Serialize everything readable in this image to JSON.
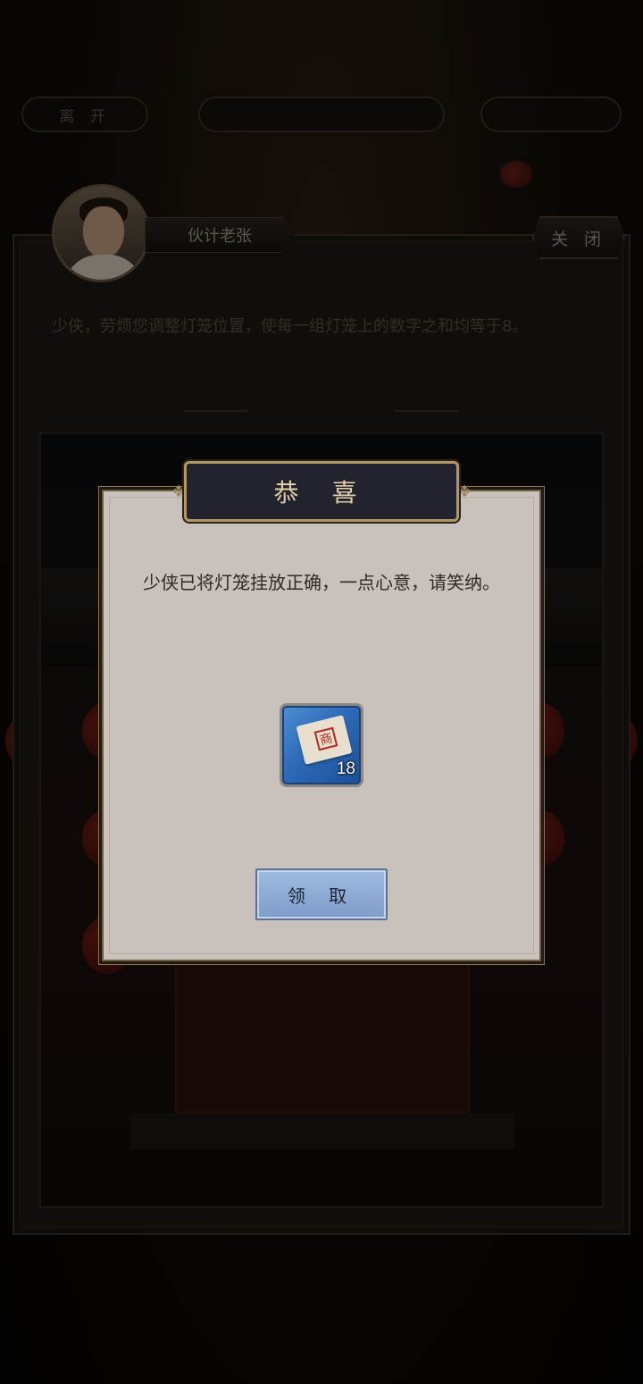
{
  "topbar": {
    "leave_label": "离 开",
    "center_label": "",
    "right_label": ""
  },
  "npc": {
    "name": "伙计老张",
    "close_label": "关 闭",
    "instruction": "少侠，劳烦您调整灯笼位置，使每一组灯笼上的数字之和均等于8。"
  },
  "dialog": {
    "title": "恭 喜",
    "message": "少侠已将灯笼挂放正确，一点心意，请笑纳。",
    "reward": {
      "icon": "scroll-icon",
      "count": "18",
      "seal_glyph": "商"
    },
    "claim_label": "领 取"
  },
  "colors": {
    "dialog_bg": "#c8c1bc",
    "title_bg": "#22232c",
    "title_text": "#e2cfa8",
    "reward_bg": "#2d6ab7",
    "claim_bg": "#8faad5"
  }
}
